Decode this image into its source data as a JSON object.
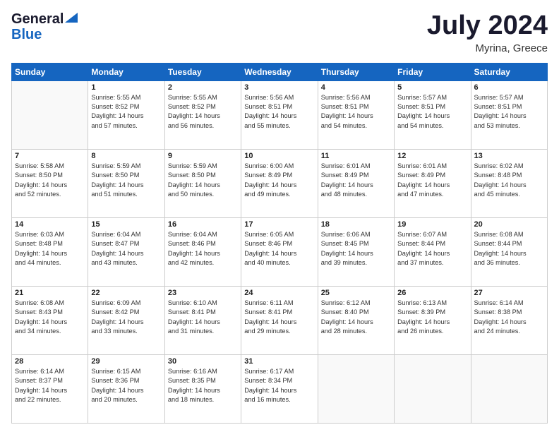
{
  "header": {
    "logo_line1": "General",
    "logo_line2": "Blue",
    "month": "July 2024",
    "location": "Myrina, Greece"
  },
  "weekdays": [
    "Sunday",
    "Monday",
    "Tuesday",
    "Wednesday",
    "Thursday",
    "Friday",
    "Saturday"
  ],
  "weeks": [
    [
      {
        "day": "",
        "sunrise": "",
        "sunset": "",
        "daylight": ""
      },
      {
        "day": "1",
        "sunrise": "Sunrise: 5:55 AM",
        "sunset": "Sunset: 8:52 PM",
        "daylight": "Daylight: 14 hours and 57 minutes."
      },
      {
        "day": "2",
        "sunrise": "Sunrise: 5:55 AM",
        "sunset": "Sunset: 8:52 PM",
        "daylight": "Daylight: 14 hours and 56 minutes."
      },
      {
        "day": "3",
        "sunrise": "Sunrise: 5:56 AM",
        "sunset": "Sunset: 8:51 PM",
        "daylight": "Daylight: 14 hours and 55 minutes."
      },
      {
        "day": "4",
        "sunrise": "Sunrise: 5:56 AM",
        "sunset": "Sunset: 8:51 PM",
        "daylight": "Daylight: 14 hours and 54 minutes."
      },
      {
        "day": "5",
        "sunrise": "Sunrise: 5:57 AM",
        "sunset": "Sunset: 8:51 PM",
        "daylight": "Daylight: 14 hours and 54 minutes."
      },
      {
        "day": "6",
        "sunrise": "Sunrise: 5:57 AM",
        "sunset": "Sunset: 8:51 PM",
        "daylight": "Daylight: 14 hours and 53 minutes."
      }
    ],
    [
      {
        "day": "7",
        "sunrise": "Sunrise: 5:58 AM",
        "sunset": "Sunset: 8:50 PM",
        "daylight": "Daylight: 14 hours and 52 minutes."
      },
      {
        "day": "8",
        "sunrise": "Sunrise: 5:59 AM",
        "sunset": "Sunset: 8:50 PM",
        "daylight": "Daylight: 14 hours and 51 minutes."
      },
      {
        "day": "9",
        "sunrise": "Sunrise: 5:59 AM",
        "sunset": "Sunset: 8:50 PM",
        "daylight": "Daylight: 14 hours and 50 minutes."
      },
      {
        "day": "10",
        "sunrise": "Sunrise: 6:00 AM",
        "sunset": "Sunset: 8:49 PM",
        "daylight": "Daylight: 14 hours and 49 minutes."
      },
      {
        "day": "11",
        "sunrise": "Sunrise: 6:01 AM",
        "sunset": "Sunset: 8:49 PM",
        "daylight": "Daylight: 14 hours and 48 minutes."
      },
      {
        "day": "12",
        "sunrise": "Sunrise: 6:01 AM",
        "sunset": "Sunset: 8:49 PM",
        "daylight": "Daylight: 14 hours and 47 minutes."
      },
      {
        "day": "13",
        "sunrise": "Sunrise: 6:02 AM",
        "sunset": "Sunset: 8:48 PM",
        "daylight": "Daylight: 14 hours and 45 minutes."
      }
    ],
    [
      {
        "day": "14",
        "sunrise": "Sunrise: 6:03 AM",
        "sunset": "Sunset: 8:48 PM",
        "daylight": "Daylight: 14 hours and 44 minutes."
      },
      {
        "day": "15",
        "sunrise": "Sunrise: 6:04 AM",
        "sunset": "Sunset: 8:47 PM",
        "daylight": "Daylight: 14 hours and 43 minutes."
      },
      {
        "day": "16",
        "sunrise": "Sunrise: 6:04 AM",
        "sunset": "Sunset: 8:46 PM",
        "daylight": "Daylight: 14 hours and 42 minutes."
      },
      {
        "day": "17",
        "sunrise": "Sunrise: 6:05 AM",
        "sunset": "Sunset: 8:46 PM",
        "daylight": "Daylight: 14 hours and 40 minutes."
      },
      {
        "day": "18",
        "sunrise": "Sunrise: 6:06 AM",
        "sunset": "Sunset: 8:45 PM",
        "daylight": "Daylight: 14 hours and 39 minutes."
      },
      {
        "day": "19",
        "sunrise": "Sunrise: 6:07 AM",
        "sunset": "Sunset: 8:44 PM",
        "daylight": "Daylight: 14 hours and 37 minutes."
      },
      {
        "day": "20",
        "sunrise": "Sunrise: 6:08 AM",
        "sunset": "Sunset: 8:44 PM",
        "daylight": "Daylight: 14 hours and 36 minutes."
      }
    ],
    [
      {
        "day": "21",
        "sunrise": "Sunrise: 6:08 AM",
        "sunset": "Sunset: 8:43 PM",
        "daylight": "Daylight: 14 hours and 34 minutes."
      },
      {
        "day": "22",
        "sunrise": "Sunrise: 6:09 AM",
        "sunset": "Sunset: 8:42 PM",
        "daylight": "Daylight: 14 hours and 33 minutes."
      },
      {
        "day": "23",
        "sunrise": "Sunrise: 6:10 AM",
        "sunset": "Sunset: 8:41 PM",
        "daylight": "Daylight: 14 hours and 31 minutes."
      },
      {
        "day": "24",
        "sunrise": "Sunrise: 6:11 AM",
        "sunset": "Sunset: 8:41 PM",
        "daylight": "Daylight: 14 hours and 29 minutes."
      },
      {
        "day": "25",
        "sunrise": "Sunrise: 6:12 AM",
        "sunset": "Sunset: 8:40 PM",
        "daylight": "Daylight: 14 hours and 28 minutes."
      },
      {
        "day": "26",
        "sunrise": "Sunrise: 6:13 AM",
        "sunset": "Sunset: 8:39 PM",
        "daylight": "Daylight: 14 hours and 26 minutes."
      },
      {
        "day": "27",
        "sunrise": "Sunrise: 6:14 AM",
        "sunset": "Sunset: 8:38 PM",
        "daylight": "Daylight: 14 hours and 24 minutes."
      }
    ],
    [
      {
        "day": "28",
        "sunrise": "Sunrise: 6:14 AM",
        "sunset": "Sunset: 8:37 PM",
        "daylight": "Daylight: 14 hours and 22 minutes."
      },
      {
        "day": "29",
        "sunrise": "Sunrise: 6:15 AM",
        "sunset": "Sunset: 8:36 PM",
        "daylight": "Daylight: 14 hours and 20 minutes."
      },
      {
        "day": "30",
        "sunrise": "Sunrise: 6:16 AM",
        "sunset": "Sunset: 8:35 PM",
        "daylight": "Daylight: 14 hours and 18 minutes."
      },
      {
        "day": "31",
        "sunrise": "Sunrise: 6:17 AM",
        "sunset": "Sunset: 8:34 PM",
        "daylight": "Daylight: 14 hours and 16 minutes."
      },
      {
        "day": "",
        "sunrise": "",
        "sunset": "",
        "daylight": ""
      },
      {
        "day": "",
        "sunrise": "",
        "sunset": "",
        "daylight": ""
      },
      {
        "day": "",
        "sunrise": "",
        "sunset": "",
        "daylight": ""
      }
    ]
  ]
}
